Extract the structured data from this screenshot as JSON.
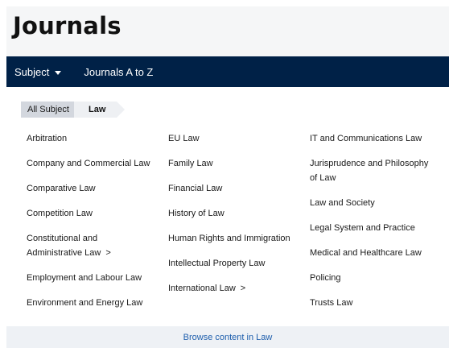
{
  "header": {
    "title": "Journals"
  },
  "nav": {
    "subject_label": "Subject",
    "atoz_label": "Journals A to Z"
  },
  "breadcrumb": {
    "all": "All Subject",
    "current": "Law"
  },
  "columns": [
    [
      "Arbitration",
      "Company and Commercial Law",
      "Comparative Law",
      "Competition Law",
      "Constitutional and Administrative Law",
      "Employment and Labour Law",
      "Environment and Energy Law"
    ],
    [
      "EU Law",
      "Family Law",
      "Financial Law",
      "History of Law",
      "Human Rights and Immigration",
      "Intellectual Property Law",
      "International Law"
    ],
    [
      "IT and Communications Law",
      "Jurisprudence and Philosophy of Law",
      "Law and Society",
      "Legal System and Practice",
      "Medical and Healthcare Law",
      "Policing",
      "Trusts Law"
    ]
  ],
  "expandable_marker": ">",
  "footer": {
    "browse_label": "Browse content in Law"
  },
  "colors": {
    "nav_bg": "#002147",
    "link": "#1f5fad"
  }
}
